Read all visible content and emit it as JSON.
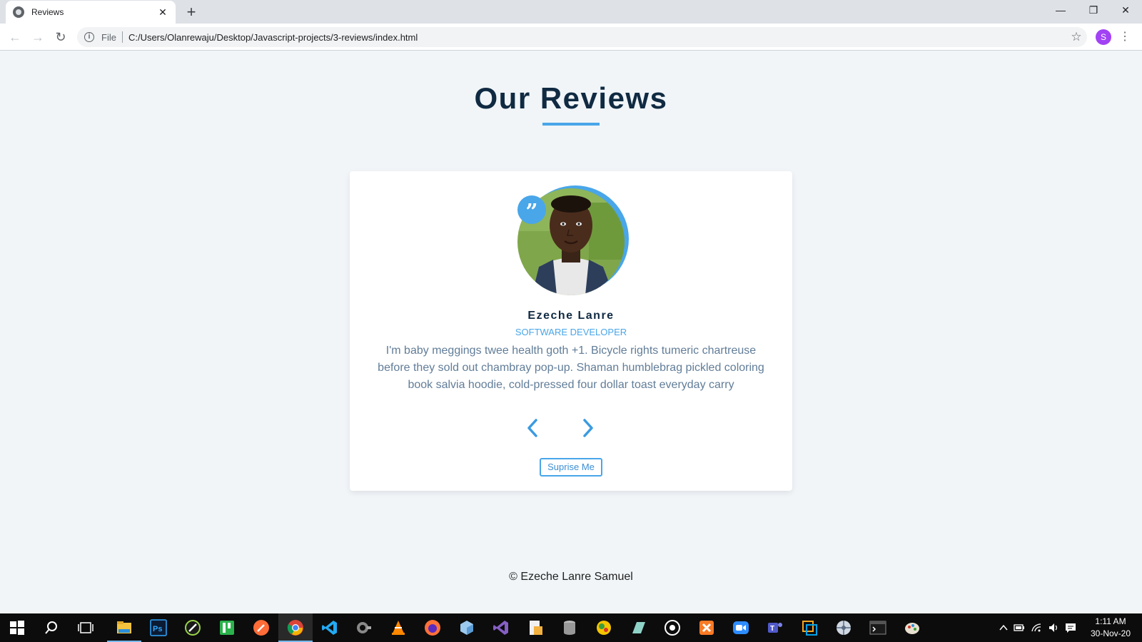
{
  "browser": {
    "tab_title": "Reviews",
    "tab_close": "✕",
    "new_tab": "+",
    "minimize": "—",
    "restore": "❐",
    "close": "✕",
    "back": "←",
    "forward": "→",
    "reload": "↻",
    "info": "i",
    "scheme_label": "File",
    "url": "C:/Users/Olanrewaju/Desktop/Javascript-projects/3-reviews/index.html",
    "bookmark": "☆",
    "profile_initial": "S",
    "menu": "⋮"
  },
  "page": {
    "heading": "Our Reviews",
    "review": {
      "quote_glyph": "”",
      "author": "Ezeche Lanre",
      "job": "software developer",
      "text": "I'm baby meggings twee health goth +1. Bicycle rights tumeric chartreuse before they sold out chambray pop-up. Shaman humblebrag pickled coloring book salvia hoodie, cold-pressed four dollar toast everyday carry",
      "prev_label": "Previous review",
      "next_label": "Next review",
      "surprise_label": "Suprise Me"
    },
    "footer": "© Ezeche Lanre Samuel"
  },
  "taskbar": {
    "time": "1:11 AM",
    "date": "30-Nov-20",
    "apps": [
      "start",
      "search",
      "task-view",
      "file-explorer",
      "photoshop",
      "inkscape",
      "app-green",
      "postman",
      "chrome",
      "vscode",
      "app-gray",
      "vlc",
      "firefox",
      "box-app",
      "visual-studio",
      "app-doc",
      "database",
      "app-color",
      "app-sky",
      "app-target",
      "xampp",
      "zoom",
      "teams",
      "app-orange",
      "app-wheel",
      "terminal",
      "paint"
    ],
    "colors": {
      "accent": "#49a6e9",
      "heading": "#102a42",
      "text": "#617d98"
    }
  }
}
